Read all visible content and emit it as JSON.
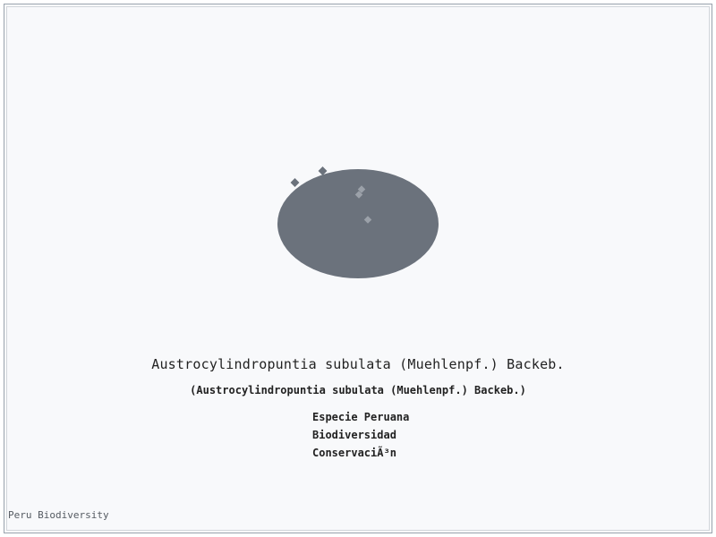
{
  "species": {
    "title": "Austrocylindropuntia subulata (Muehlenpf.) Backeb.",
    "subtitle": "(Austrocylindropuntia subulata (Muehlenpf.) Backeb.)"
  },
  "tags": [
    "Especie Peruana",
    "Biodiversidad",
    "ConservaciÃ³n"
  ],
  "footer": {
    "brand": "Peru Biodiversity"
  },
  "colors": {
    "shape": "#6b727c",
    "marker": "#9ba1a9",
    "border": "#9aa3ad",
    "text": "#222222"
  }
}
